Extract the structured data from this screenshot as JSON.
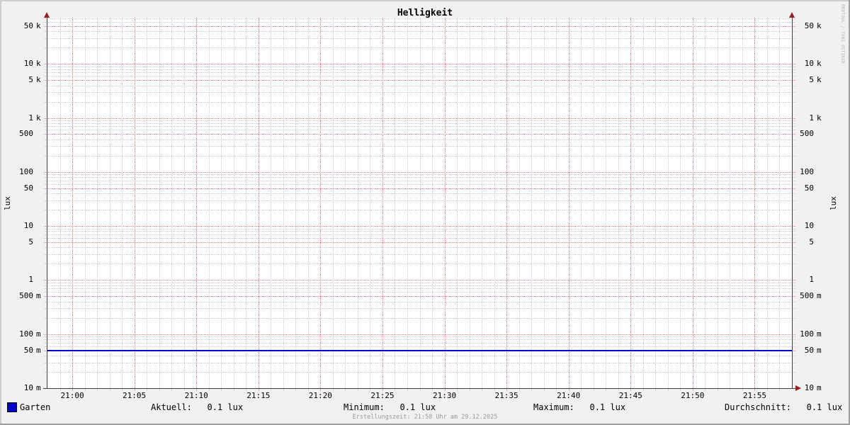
{
  "title": "Helligkeit",
  "watermark": "RRDTOOL / TOBI OETIKER",
  "footer": "Erstellungszeit: 21:58 Uhr am 29.12.2025",
  "y_axis_unit_left": "lux",
  "y_axis_unit_right": "lux",
  "legend": {
    "series_label": "Garten",
    "series_color": "#0000cc"
  },
  "colors": {
    "background": "#f1f1f1",
    "canvas": "#ffffff",
    "grid_major": "#de7b7b",
    "grid_minor": "#c8c8c8",
    "axis": "#3f3f3f",
    "arrow": "#991f1f",
    "series": "#0000cc",
    "border_light": "#cdcdcd",
    "border_dark": "#9e9e9e"
  },
  "chart_data": {
    "type": "line",
    "title": "Helligkeit",
    "ylabel": "lux",
    "y_scale": "log",
    "ylim": [
      0.01,
      70000
    ],
    "grid": "on",
    "x_range_minutes": 60,
    "x_start": "20:58",
    "x_end": "21:58",
    "x_ticks": [
      {
        "minute": 2,
        "label": "21:00"
      },
      {
        "minute": 7,
        "label": "21:05"
      },
      {
        "minute": 12,
        "label": "21:10"
      },
      {
        "minute": 17,
        "label": "21:15"
      },
      {
        "minute": 22,
        "label": "21:20"
      },
      {
        "minute": 27,
        "label": "21:25"
      },
      {
        "minute": 32,
        "label": "21:30"
      },
      {
        "minute": 37,
        "label": "21:35"
      },
      {
        "minute": 42,
        "label": "21:40"
      },
      {
        "minute": 47,
        "label": "21:45"
      },
      {
        "minute": 52,
        "label": "21:50"
      },
      {
        "minute": 57,
        "label": "21:55"
      }
    ],
    "y_ticks": [
      {
        "value": 50000,
        "num": "50",
        "unit": "k"
      },
      {
        "value": 10000,
        "num": "10",
        "unit": "k"
      },
      {
        "value": 5000,
        "num": "5",
        "unit": "k"
      },
      {
        "value": 1000,
        "num": "1",
        "unit": "k"
      },
      {
        "value": 500,
        "num": "500",
        "unit": ""
      },
      {
        "value": 100,
        "num": "100",
        "unit": ""
      },
      {
        "value": 50,
        "num": "50",
        "unit": ""
      },
      {
        "value": 10,
        "num": "10",
        "unit": ""
      },
      {
        "value": 5,
        "num": "5",
        "unit": ""
      },
      {
        "value": 1,
        "num": "1",
        "unit": ""
      },
      {
        "value": 0.5,
        "num": "500",
        "unit": "m"
      },
      {
        "value": 0.1,
        "num": "100",
        "unit": "m"
      },
      {
        "value": 0.05,
        "num": "50",
        "unit": "m"
      },
      {
        "value": 0.01,
        "num": "10",
        "unit": "m"
      }
    ],
    "series": [
      {
        "name": "Garten",
        "color": "#0000cc",
        "constant_value": 0.05
      }
    ],
    "stats": [
      {
        "label": "Aktuell:",
        "value": "0.1 lux"
      },
      {
        "label": "Minimum:",
        "value": "0.1 lux"
      },
      {
        "label": "Maximum:",
        "value": "0.1 lux"
      },
      {
        "label": "Durchschnitt:",
        "value": "0.1 lux"
      }
    ]
  }
}
